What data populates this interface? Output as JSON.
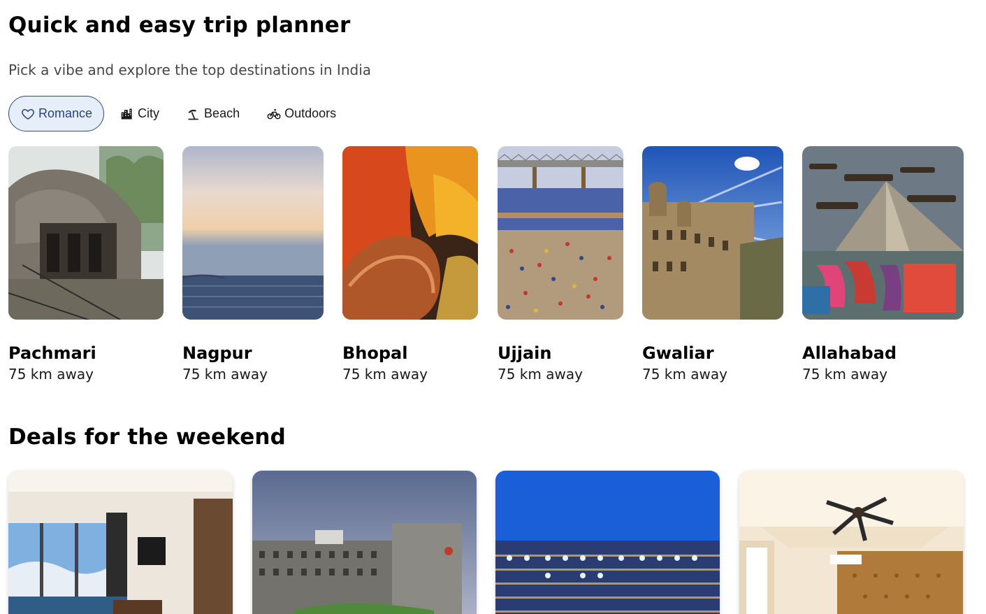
{
  "planner": {
    "title": "Quick and easy trip planner",
    "subtitle": "Pick a vibe and explore the top destinations in India",
    "vibes": [
      {
        "label": "Romance",
        "icon": "heart-icon",
        "active": true
      },
      {
        "label": "City",
        "icon": "city-icon",
        "active": false
      },
      {
        "label": "Beach",
        "icon": "beach-umbrella-icon",
        "active": false
      },
      {
        "label": "Outdoors",
        "icon": "bicycle-icon",
        "active": false
      }
    ],
    "destinations": [
      {
        "name": "Pachmari",
        "distance": "75 km away"
      },
      {
        "name": "Nagpur",
        "distance": "75 km away"
      },
      {
        "name": "Bhopal",
        "distance": "75 km away"
      },
      {
        "name": "Ujjain",
        "distance": "75 km away"
      },
      {
        "name": "Gwaliar",
        "distance": "75 km away"
      },
      {
        "name": "Allahabad",
        "distance": "75 km away"
      }
    ]
  },
  "deals": {
    "title": "Deals for the weekend"
  },
  "colors": {
    "accent": "#2f4a7e",
    "chip_active_bg": "#e6eef9"
  }
}
